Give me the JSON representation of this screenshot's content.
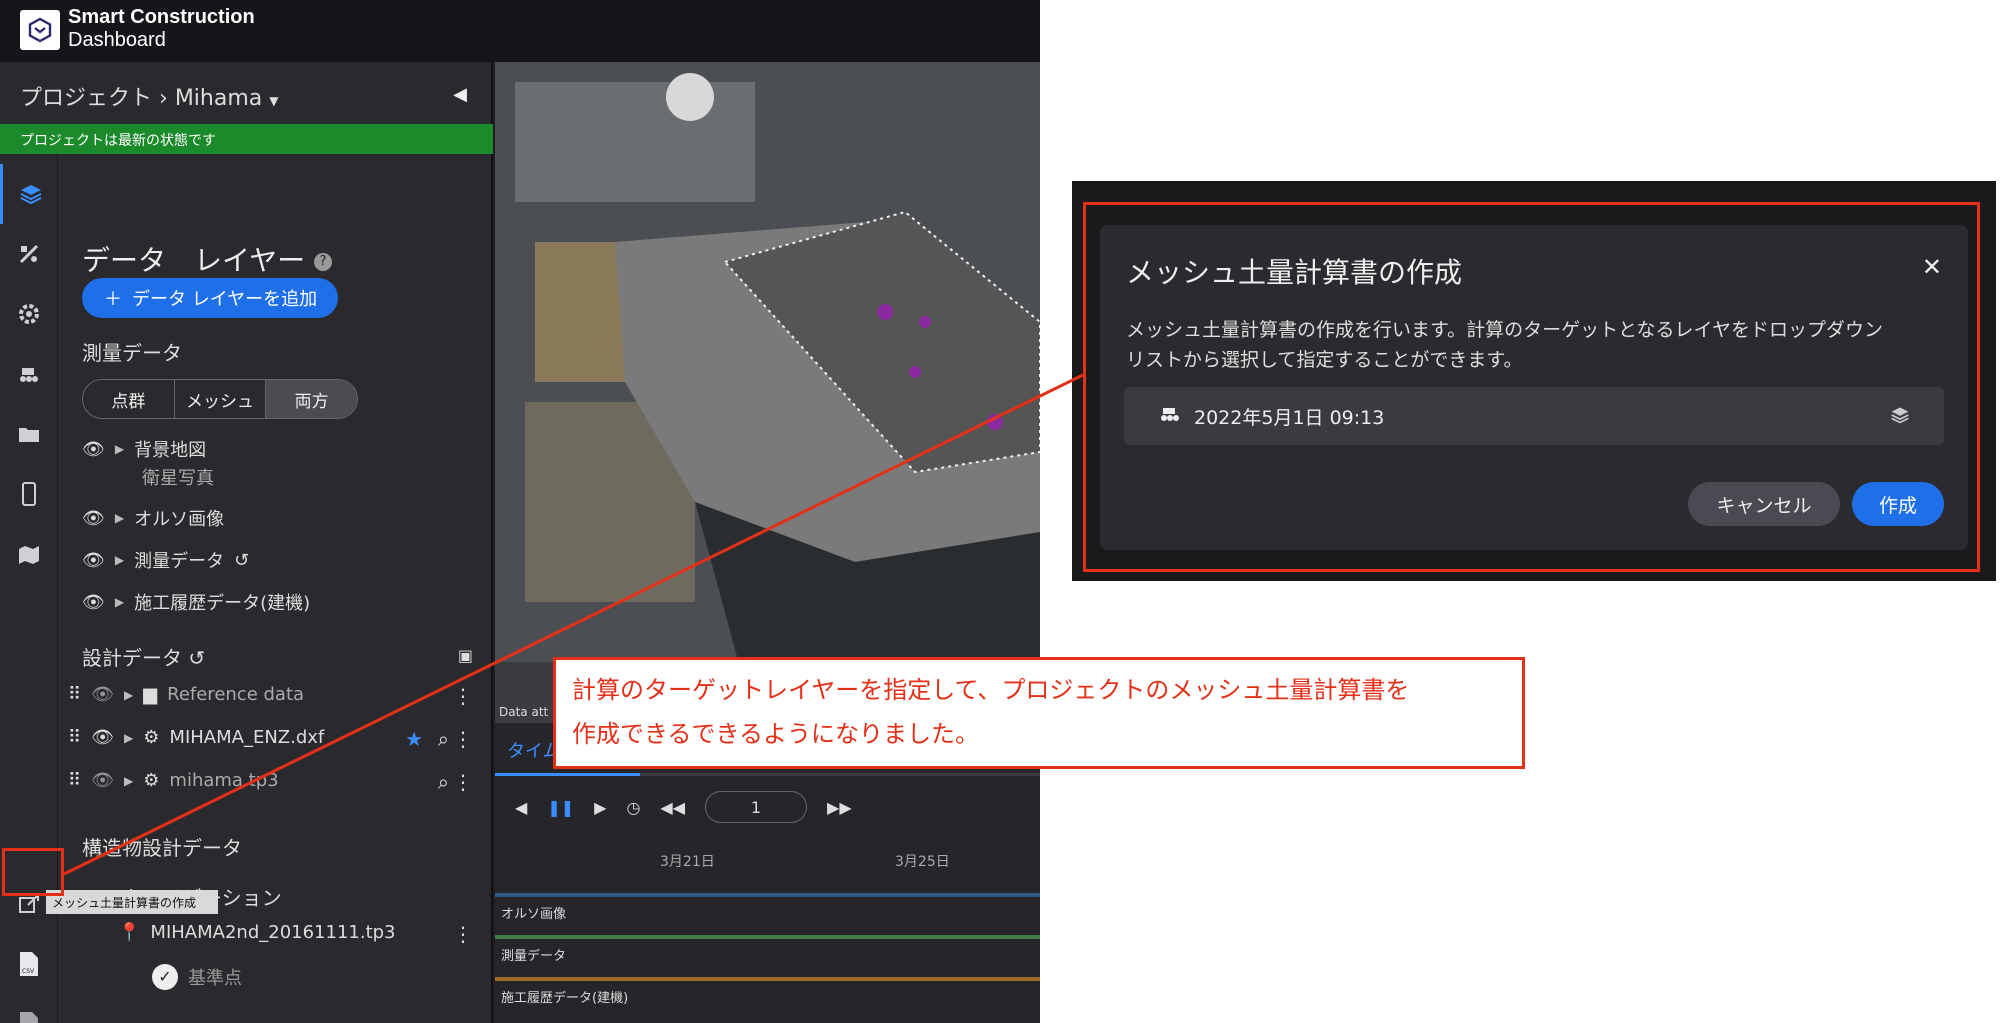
{
  "app": {
    "logo_line1": "Smart Construction",
    "logo_line2": "Dashboard",
    "breadcrumb_root": "プロジェクト",
    "breadcrumb_sep": "›",
    "project_name": "Mihama",
    "status_text": "プロジェクトは最新の状態です"
  },
  "sidebar": {
    "data_layer_title": "データ　レイヤー",
    "add_layer_label": "データ レイヤーを追加",
    "survey_section": "測量データ",
    "segments": [
      "点群",
      "メッシュ",
      "両方"
    ],
    "layers": [
      {
        "name": "背景地図",
        "sub": "衛星写真"
      },
      {
        "name": "オルソ画像"
      },
      {
        "name": "測量データ"
      },
      {
        "name": "施工履歴データ(建機)"
      }
    ],
    "design_section": "設計データ",
    "design_items": [
      "Reference data",
      "MIHAMA_ENZ.dxf",
      "mihama.tp3"
    ],
    "structure_section": "構造物設計データ",
    "localization_section": "ローカライゼーション",
    "localization_file": "MIHAMA2nd_20161111.tp3",
    "benchmark_label": "基準点",
    "tooltip": "メッシュ土量計算書の作成"
  },
  "timeline": {
    "tab_label": "タイム",
    "frame_value": "1",
    "dates": [
      "3月21日",
      "3月25日"
    ],
    "tracks": [
      "オルソ画像",
      "測量データ",
      "施工履歴データ(建機)"
    ],
    "track_colors": [
      "#2f5c85",
      "#3f7a4b",
      "#9a6a2a"
    ]
  },
  "map": {
    "attribution": "Data att"
  },
  "dialog": {
    "title": "メッシュ土量計算書の作成",
    "desc_line1": "メッシュ土量計算書の作成を行います。計算のターゲットとなるレイヤをドロップダウン",
    "desc_line2": "リストから選択して指定することができます。",
    "selected_value": "2022年5月1日 09:13",
    "cancel_label": "キャンセル",
    "create_label": "作成"
  },
  "callout": {
    "line1": "計算のターゲットレイヤーを指定して、プロジェクトのメッシュ土量計算書を",
    "line2": "作成できるできるようになりました。"
  },
  "colors": {
    "accent": "#1f6fe8",
    "highlight": "#e53018",
    "status_green": "#1a8a2a"
  }
}
